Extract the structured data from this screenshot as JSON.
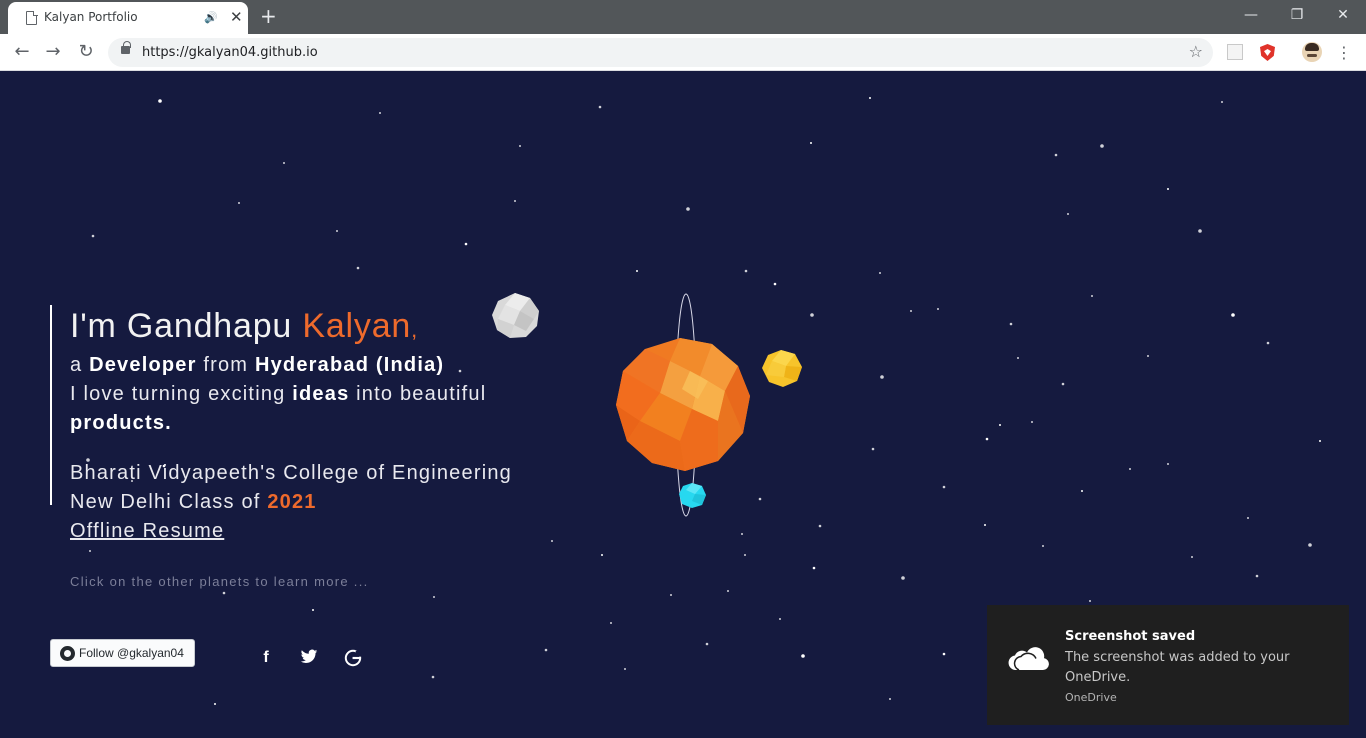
{
  "browser": {
    "tab_title": "Kalyan Portfolio",
    "tab_close": "✕",
    "new_tab": "+",
    "url": "https://gkalyan04.github.io",
    "window": {
      "minimize": "—",
      "restore": "❐",
      "close": "✕"
    },
    "nav": {
      "back": "←",
      "forward": "→",
      "reload": "↻"
    },
    "star": "☆",
    "menu": "⋮"
  },
  "hero": {
    "greet_prefix": "I'm Gandhapu ",
    "greet_name": "Kalyan",
    "greet_comma": ",",
    "line1_a": "a ",
    "line1_b": "Developer",
    "line1_c": " from ",
    "line1_d": "Hyderabad (India)",
    "line2_a": "I love turning exciting ",
    "line2_b": "ideas",
    "line2_c": " into beautiful",
    "line3": "products.",
    "college": "Bharati Vidyapeeth's College of Engineering",
    "class_prefix": "New Delhi Class of ",
    "class_year": "2021",
    "resume": "Offline Resume"
  },
  "hint": "Click on the other planets to learn more ...",
  "footer": {
    "follow_label": "Follow @gkalyan04",
    "facebook": "f",
    "twitter": "🐦",
    "google": "G"
  },
  "toast": {
    "title": "Screenshot saved",
    "body": "The screenshot was added to your OneDrive.",
    "source": "OneDrive"
  },
  "colors": {
    "background": "#151a3f",
    "accent": "#ee6a2c",
    "sun": "#f07a22",
    "planet_yellow": "#f7c42b",
    "planet_cyan": "#27d8f0",
    "moon": "#d9d9d9"
  },
  "icons": [
    "page-icon",
    "audio-icon",
    "lock-icon",
    "star-icon",
    "github-icon",
    "facebook-icon",
    "twitter-icon",
    "google-icon",
    "cloud-icon"
  ]
}
